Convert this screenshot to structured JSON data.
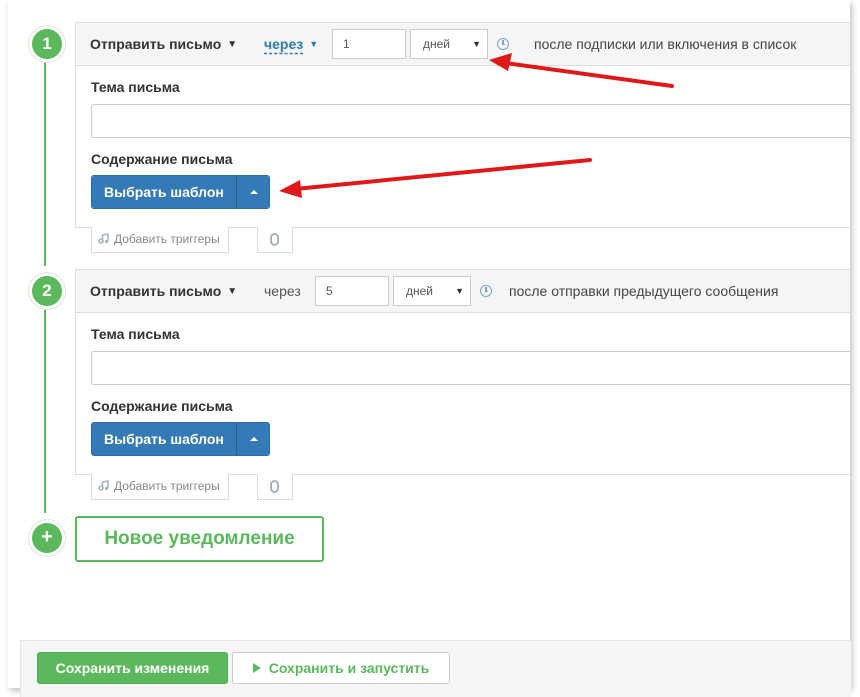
{
  "steps": [
    {
      "number": "1",
      "send_label": "Отправить письмо",
      "via_label": "через",
      "delay_value": "1",
      "delay_unit": "дней",
      "description": "после подписки или включения в список",
      "subject_label": "Тема письма",
      "subject_value": "",
      "content_label": "Содержание письма",
      "template_button": "Выбрать шаблон",
      "add_triggers": "Добавить триггеры"
    },
    {
      "number": "2",
      "send_label": "Отправить письмо",
      "via_label": "через",
      "delay_value": "5",
      "delay_unit": "дней",
      "description": "после отправки предыдущего сообщения",
      "subject_label": "Тема письма",
      "subject_value": "",
      "content_label": "Содержание письма",
      "template_button": "Выбрать шаблон",
      "add_triggers": "Добавить триггеры"
    }
  ],
  "new_notification": {
    "plus": "+",
    "label": "Новое уведомление"
  },
  "footer": {
    "save_label": "Сохранить изменения",
    "save_run_label": "Сохранить и запустить"
  },
  "icons": {
    "dropdown": "caret-down-icon",
    "clock": "clock-icon",
    "trigger": "music-note-icon",
    "attach": "paperclip-icon",
    "play": "play-icon"
  },
  "colors": {
    "accent_green": "#5cb85c",
    "primary_blue": "#337ab7",
    "link_blue": "#2a7ab0",
    "annotation_red": "#e01818"
  }
}
